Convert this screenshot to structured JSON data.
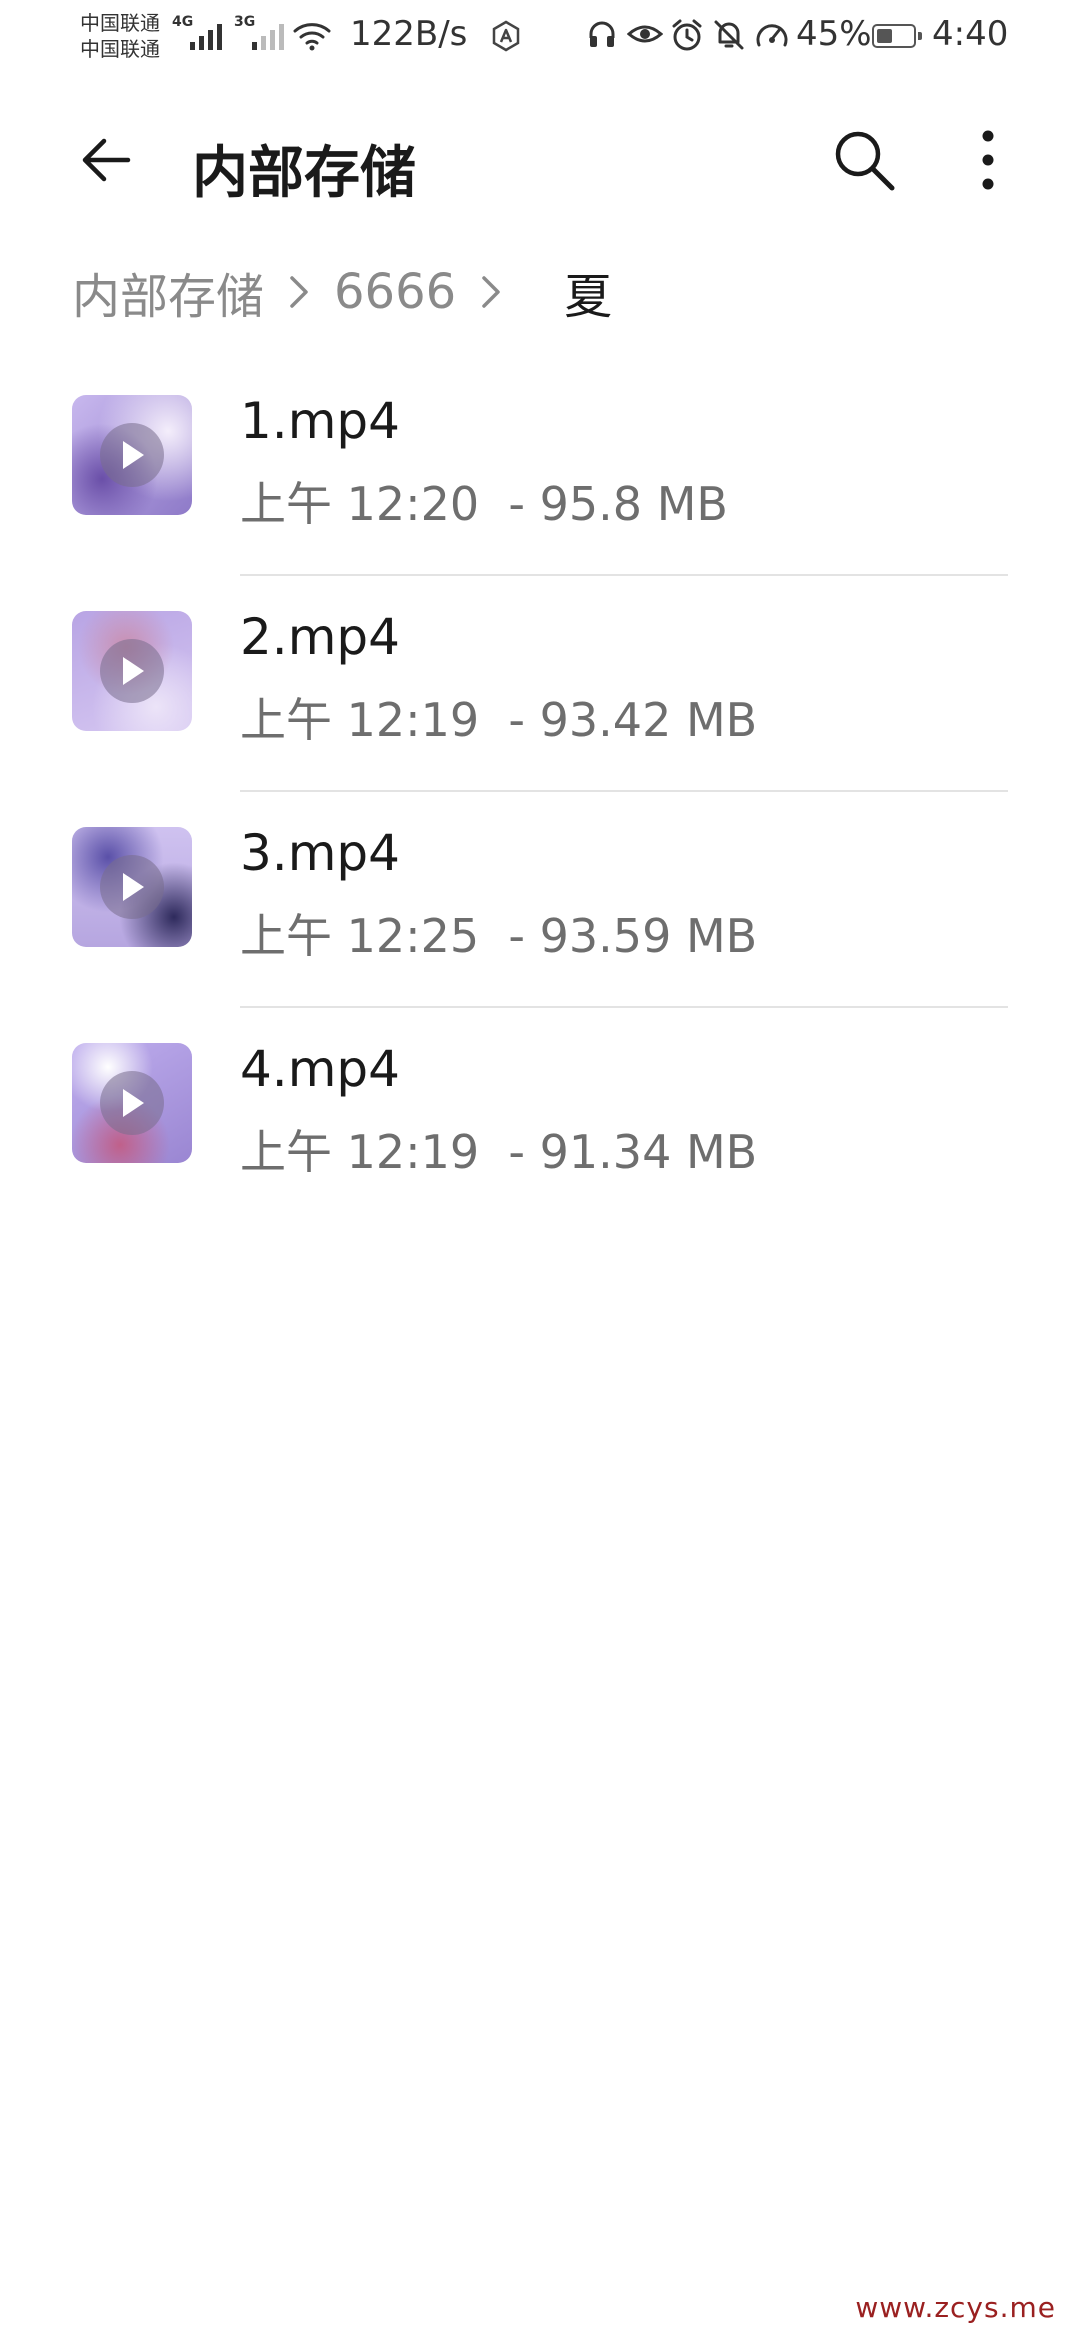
{
  "status_bar": {
    "carrier_1": "中国联通",
    "carrier_2": "中国联通",
    "signal_1_tag": "4G",
    "signal_2_tag": "3G",
    "network_speed": "122B/s",
    "battery_percent": "45%",
    "battery_level": 0.45,
    "time": "4:40",
    "icons": [
      "wifi-icon",
      "nfc-icon",
      "headphones-icon",
      "eye-icon",
      "alarm-icon",
      "mute-bell-icon",
      "speed-icon"
    ]
  },
  "title_bar": {
    "title": "内部存储",
    "back_icon": "arrow-left-icon",
    "search_icon": "search-icon",
    "more_icon": "more-vertical-icon"
  },
  "breadcrumb": {
    "items": [
      "内部存储",
      "6666"
    ],
    "current": "夏"
  },
  "files": [
    {
      "name": "1.mp4",
      "meta": "上午 12:20  - 95.8 MB"
    },
    {
      "name": "2.mp4",
      "meta": "上午 12:19  - 93.42 MB"
    },
    {
      "name": "3.mp4",
      "meta": "上午 12:25  - 93.59 MB"
    },
    {
      "name": "4.mp4",
      "meta": "上午 12:19  - 91.34 MB"
    }
  ],
  "watermark": "www.zcys.me",
  "colors": {
    "text_primary": "#1a1a1a",
    "text_secondary": "#6e6e6e",
    "breadcrumb_inactive": "#8a8a8a",
    "divider": "#e3e3e3",
    "thumb_tint": "#b6a6e0"
  }
}
